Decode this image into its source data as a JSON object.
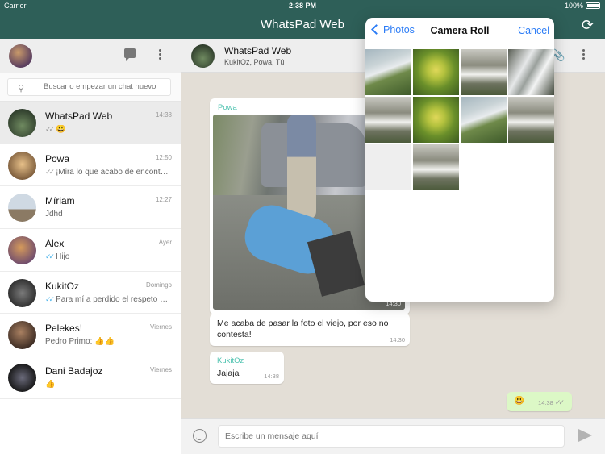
{
  "status_bar": {
    "carrier": "Carrier",
    "time": "2:38 PM",
    "battery": "100%"
  },
  "app": {
    "title": "WhatsPad Web"
  },
  "sidebar": {
    "search_placeholder": "Buscar o empezar un chat nuevo",
    "chats": [
      {
        "name": "WhatsPad Web",
        "time": "14:38",
        "preview": "😃",
        "tick": "grey"
      },
      {
        "name": "Powa",
        "time": "12:50",
        "preview": "¡Mira lo que acabo de encontrar!",
        "tick": "grey"
      },
      {
        "name": "Míriam",
        "time": "12:27",
        "preview": "Jdhd",
        "tick": ""
      },
      {
        "name": "Alex",
        "time": "Ayer",
        "preview": "Hijo",
        "tick": "blue"
      },
      {
        "name": "KukitOz",
        "time": "Domingo",
        "preview": "Para mí a perdido el respeto del todo",
        "tick": "blue"
      },
      {
        "name": "Pelekes!",
        "time": "Viernes",
        "preview": "Pedro Primo: 👍👍",
        "tick": ""
      },
      {
        "name": "Dani Badajoz",
        "time": "Viernes",
        "preview": "👍",
        "tick": ""
      }
    ]
  },
  "conversation": {
    "title": "WhatsPad Web",
    "subtitle": "KukitOz, Powa, Tú",
    "messages": {
      "photo": {
        "sender": "Powa",
        "time": "14:30"
      },
      "caption": {
        "text": "Me acaba de pasar la foto el viejo, por eso no contesta!",
        "time": "14:30"
      },
      "kukitoz": {
        "sender": "KukitOz",
        "text": "Jajaja",
        "time": "14:38"
      },
      "outgoing": {
        "text": "😃",
        "time": "14:38"
      }
    },
    "composer_placeholder": "Escribe un mensaje aquí"
  },
  "photo_picker": {
    "back_label": "Photos",
    "title": "Camera Roll",
    "cancel_label": "Cancel",
    "thumbnails": [
      "water",
      "plant",
      "falls",
      "river",
      "falls",
      "plant",
      "water",
      "falls",
      "gray",
      "falls"
    ]
  },
  "colors": {
    "header": "#2e5f58",
    "accent_blue": "#2b7cf6",
    "outgoing_bubble": "#dcf8c6",
    "sender_green": "#4fc3b0"
  }
}
